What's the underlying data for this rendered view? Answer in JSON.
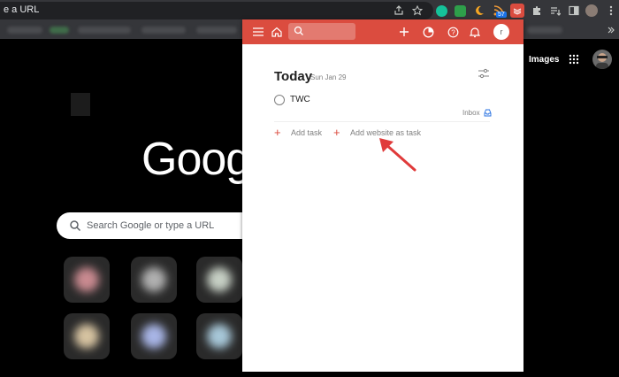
{
  "browser": {
    "url_text": "e a URL",
    "extension_badge": "57"
  },
  "ntp": {
    "logo_text": "Goog",
    "search_placeholder": "Search Google or type a URL",
    "images_link": "Images"
  },
  "todoist": {
    "avatar_initial": "r",
    "view_title": "Today",
    "date": "Sun Jan 29",
    "task": {
      "name": "TWC",
      "project": "Inbox"
    },
    "add_task_label": "Add task",
    "add_website_label": "Add website as task"
  },
  "colors": {
    "todoist_red": "#db4c3f",
    "annotation_arrow": "#e03a3a",
    "chrome_toolbar": "#35363a"
  }
}
